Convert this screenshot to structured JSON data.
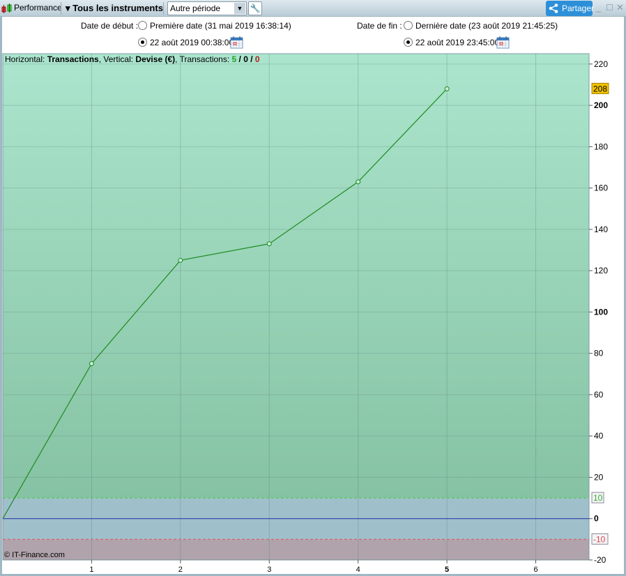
{
  "toolbar": {
    "app_title": "Performance",
    "instruments": "Tous les instruments",
    "period": "Autre période",
    "share": "Partager"
  },
  "dates": {
    "start_label": "Date de début :",
    "start_first": "Première date (31 mai 2019 16:38:14)",
    "start_custom": "22 août 2019 00:38:00",
    "start_selected": "custom",
    "end_label": "Date de fin :",
    "end_last": "Dernière date (23 août 2019 21:45:25)",
    "end_custom": "22 août 2019 23:45:00",
    "end_selected": "custom"
  },
  "info": {
    "h_label": "Horizontal: ",
    "h_value": "Transactions",
    "v_label": ", Vertical: ",
    "v_value": "Devise (€)",
    "t_label": ", Transactions: ",
    "t_win": "5",
    "sep1": " / ",
    "t_neutral": "0",
    "sep2": " / ",
    "t_loss": "0"
  },
  "copyright": "© IT-Finance.com",
  "colors": {
    "line": "#1e8a1e",
    "upper_threshold": "#44cc44",
    "lower_threshold": "#e05555",
    "zero_line": "#2233aa",
    "last_value_badge": "#f2c200"
  },
  "chart_data": {
    "type": "line",
    "xlabel": "Transactions",
    "ylabel": "Devise (€)",
    "x": [
      0,
      1,
      2,
      3,
      4,
      5
    ],
    "y": [
      0,
      75,
      125,
      133,
      163,
      208
    ],
    "xlim": [
      0,
      6.6
    ],
    "ylim": [
      -20,
      225
    ],
    "xticks": [
      "1",
      "2",
      "3",
      "4",
      "5",
      "6"
    ],
    "yticks": [
      "-20",
      "0",
      "20",
      "40",
      "60",
      "80",
      "100",
      "120",
      "140",
      "160",
      "180",
      "200",
      "220"
    ],
    "thresholds": [
      {
        "value": 10,
        "label": "10"
      },
      {
        "value": -10,
        "label": "-10"
      }
    ],
    "last_value_label": "208",
    "grid": true
  }
}
